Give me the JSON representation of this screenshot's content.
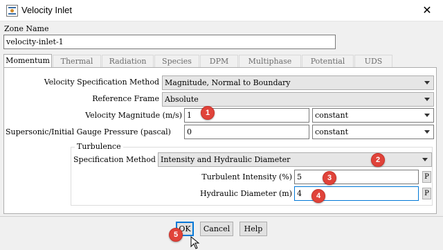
{
  "window": {
    "title": "Velocity Inlet",
    "close_glyph": "✕"
  },
  "zone": {
    "label": "Zone Name",
    "value": "velocity-inlet-1"
  },
  "tabs": [
    {
      "label": "Momentum",
      "selected": true
    },
    {
      "label": "Thermal"
    },
    {
      "label": "Radiation"
    },
    {
      "label": "Species"
    },
    {
      "label": "DPM"
    },
    {
      "label": "Multiphase"
    },
    {
      "label": "Potential"
    },
    {
      "label": "UDS"
    }
  ],
  "momentum": {
    "velocity_spec_label": "Velocity Specification Method",
    "velocity_spec_value": "Magnitude, Normal to Boundary",
    "reference_frame_label": "Reference Frame",
    "reference_frame_value": "Absolute",
    "velocity_magnitude_label": "Velocity Magnitude (m/s)",
    "velocity_magnitude_value": "1",
    "velocity_magnitude_mode": "constant",
    "gauge_pressure_label": "Supersonic/Initial Gauge Pressure (pascal)",
    "gauge_pressure_value": "0",
    "gauge_pressure_mode": "constant"
  },
  "turbulence": {
    "group_label": "Turbulence",
    "spec_method_label": "Specification Method",
    "spec_method_value": "Intensity and Hydraulic Diameter",
    "intensity_label": "Turbulent Intensity (%)",
    "intensity_value": "5",
    "hydraulic_diameter_label": "Hydraulic Diameter (m)",
    "hydraulic_diameter_value": "4",
    "param_button_label": "P"
  },
  "buttons": {
    "ok": "OK",
    "cancel": "Cancel",
    "help": "Help"
  },
  "annotations": [
    "1",
    "2",
    "3",
    "4",
    "5"
  ],
  "colors": {
    "badge": "#e0433a",
    "focus": "#0078d7",
    "window_bg": "#f0f0f0"
  }
}
